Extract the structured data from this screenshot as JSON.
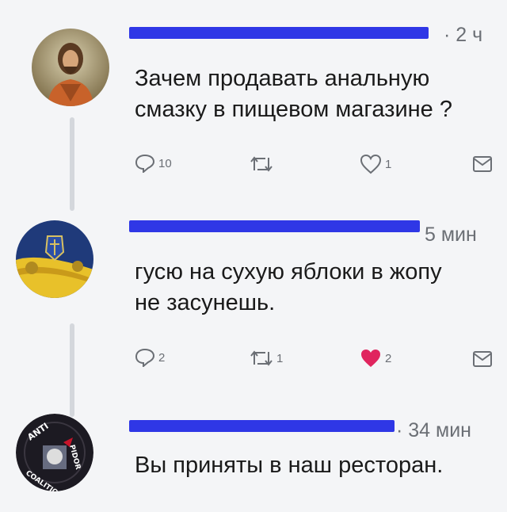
{
  "tweets": [
    {
      "time": "· 2 ч",
      "text": "Зачем продавать анальную\nсмазку в пищевом магазине ?",
      "reply_count": "10",
      "retweet_count": "",
      "like_count": "1",
      "liked": false,
      "avatar_icon": "person-portrait-icon"
    },
    {
      "time": "5 мин",
      "text": "гусю на сухую яблоки в жопу\nне засунешь.",
      "reply_count": "2",
      "retweet_count": "1",
      "like_count": "2",
      "liked": true,
      "avatar_icon": "flag-emblem-icon"
    },
    {
      "time": "· 34 мин",
      "text": "Вы приняты в наш ресторан.",
      "avatar_icon": "anti-pidor-coalition-logo",
      "avatar_text": [
        "ANTI",
        "PIDOR",
        "COALITION"
      ]
    }
  ],
  "colors": {
    "redaction": "#2f37e6",
    "like_active": "#e0245e",
    "icon_gray": "#6b6f75",
    "thread_line": "#d4d7dc"
  }
}
